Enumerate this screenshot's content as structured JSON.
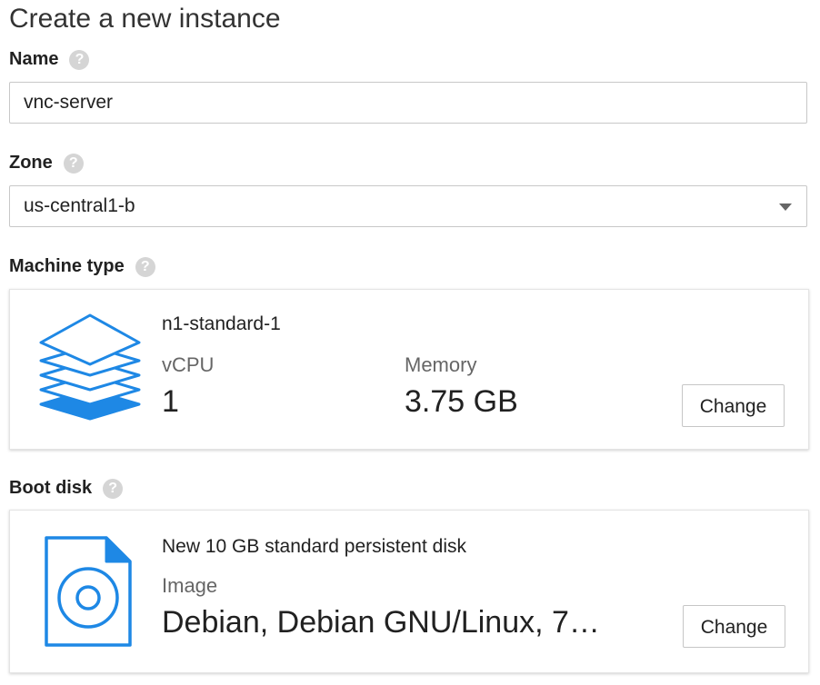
{
  "page": {
    "title": "Create a new instance"
  },
  "name": {
    "label": "Name",
    "help": "?",
    "value": "vnc-server"
  },
  "zone": {
    "label": "Zone",
    "help": "?",
    "value": "us-central1-b"
  },
  "machine": {
    "label": "Machine type",
    "help": "?",
    "type_name": "n1-standard-1",
    "vcpu_label": "vCPU",
    "vcpu_value": "1",
    "memory_label": "Memory",
    "memory_value": "3.75 GB",
    "change_label": "Change",
    "icon": "layers-icon",
    "accent_color": "#1e88e5"
  },
  "boot_disk": {
    "label": "Boot disk",
    "help": "?",
    "description": "New 10 GB standard persistent disk",
    "image_label": "Image",
    "image_value": "Debian, Debian GNU/Linux, 7…",
    "change_label": "Change",
    "icon": "disk-file-icon",
    "accent_color": "#1e88e5"
  }
}
